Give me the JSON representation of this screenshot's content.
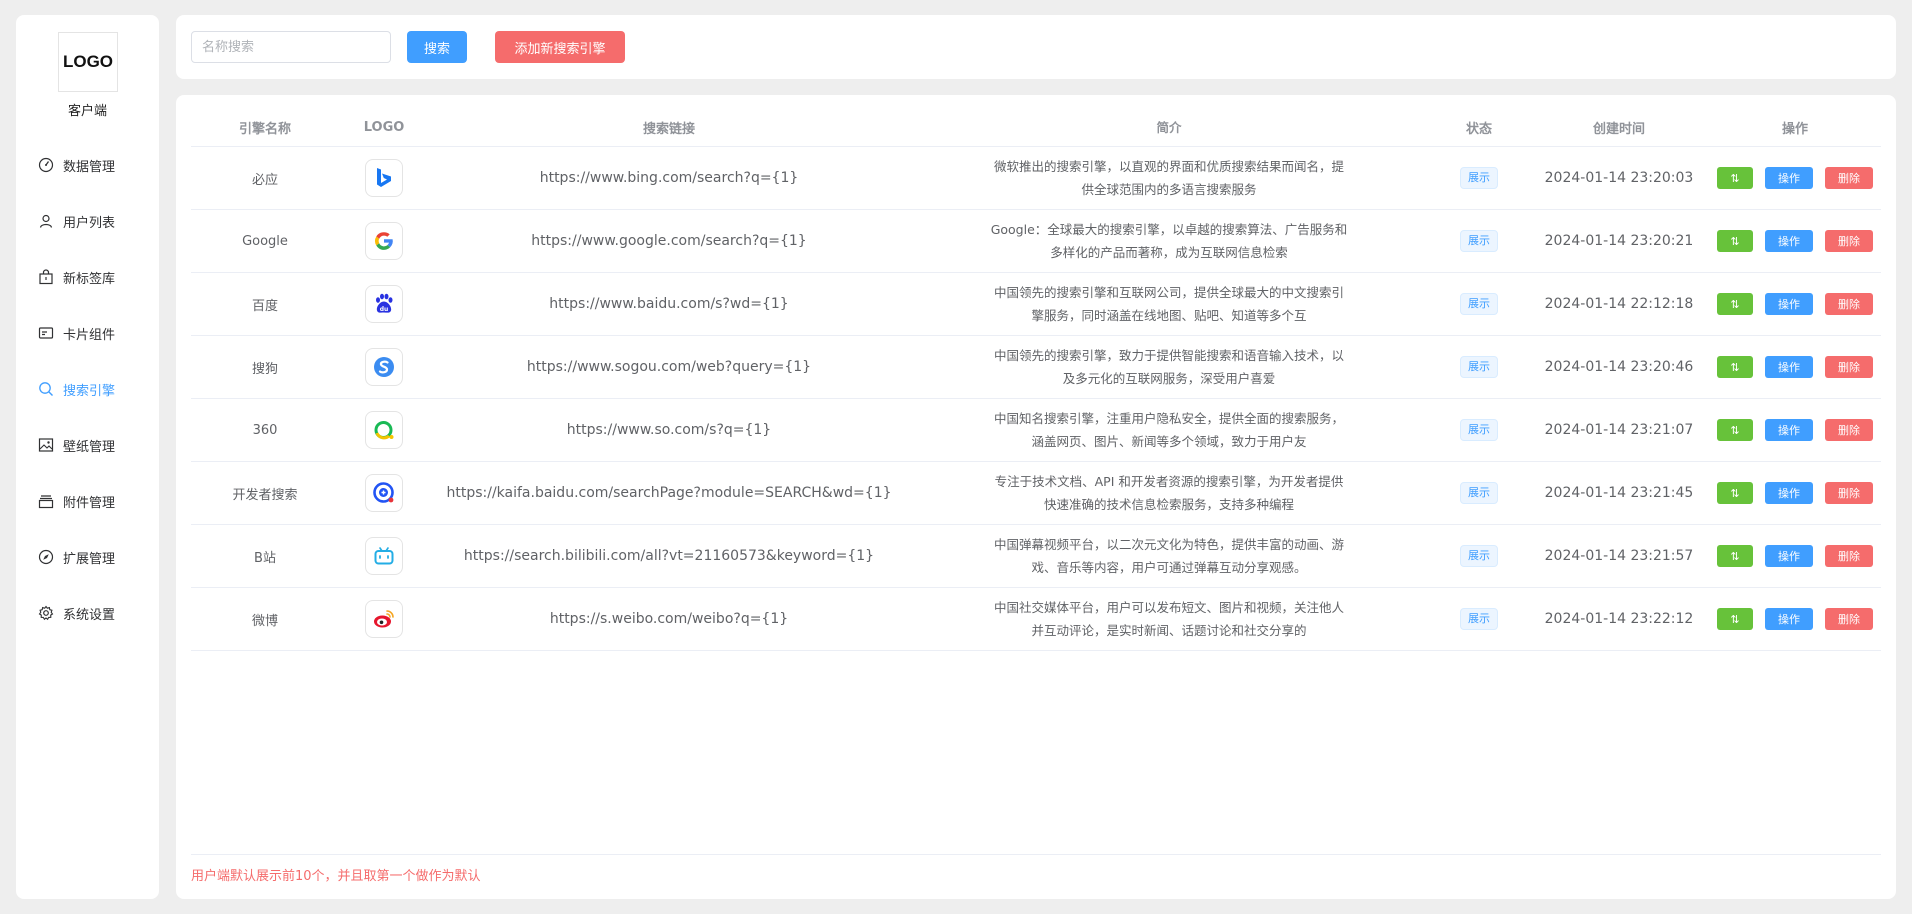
{
  "sidebar": {
    "logo_text": "LOGO",
    "caption": "客户端",
    "items": [
      {
        "label": "数据管理",
        "icon": "dashboard-icon"
      },
      {
        "label": "用户列表",
        "icon": "user-icon"
      },
      {
        "label": "新标签库",
        "icon": "shopping-bag-icon"
      },
      {
        "label": "卡片组件",
        "icon": "card-icon"
      },
      {
        "label": "搜索引擎",
        "icon": "search-icon",
        "active": true
      },
      {
        "label": "壁纸管理",
        "icon": "picture-icon"
      },
      {
        "label": "附件管理",
        "icon": "box-icon"
      },
      {
        "label": "扩展管理",
        "icon": "compass-icon"
      },
      {
        "label": "系统设置",
        "icon": "gear-icon"
      }
    ]
  },
  "toolbar": {
    "search_placeholder": "名称搜索",
    "search_value": "",
    "search_label": "搜索",
    "add_label": "添加新搜索引擎"
  },
  "table": {
    "headers": {
      "name": "引擎名称",
      "logo": "LOGO",
      "url": "搜索链接",
      "desc": "简介",
      "status": "状态",
      "time": "创建时间",
      "ops": "操作"
    },
    "status_label": "展示",
    "sort_label": "⇅",
    "op_label": "操作",
    "del_label": "删除",
    "rows": [
      {
        "name": "必应",
        "logo": "bing-logo-icon",
        "url": "https://www.bing.com/search?q={1}",
        "desc1": "微软推出的搜索引擎，以直观的界面和优质搜索结果而闻名，提",
        "desc2": "供全球范围内的多语言搜索服务",
        "time": "2024-01-14 23:20:03"
      },
      {
        "name": "Google",
        "logo": "google-logo-icon",
        "url": "https://www.google.com/search?q={1}",
        "desc1": "Google：全球最大的搜索引擎，以卓越的搜索算法、广告服务和",
        "desc2": "多样化的产品而著称，成为互联网信息检索",
        "time": "2024-01-14 23:20:21"
      },
      {
        "name": "百度",
        "logo": "baidu-logo-icon",
        "url": "https://www.baidu.com/s?wd={1}",
        "desc1": "中国领先的搜索引擎和互联网公司，提供全球最大的中文搜索引",
        "desc2": "擎服务，同时涵盖在线地图、贴吧、知道等多个互",
        "time": "2024-01-14 22:12:18"
      },
      {
        "name": "搜狗",
        "logo": "sogou-logo-icon",
        "url": "https://www.sogou.com/web?query={1}",
        "desc1": "中国领先的搜索引擎，致力于提供智能搜索和语音输入技术，以",
        "desc2": "及多元化的互联网服务，深受用户喜爱",
        "time": "2024-01-14 23:20:46"
      },
      {
        "name": "360",
        "logo": "so360-logo-icon",
        "url": "https://www.so.com/s?q={1}",
        "desc1": "中国知名搜索引擎，注重用户隐私安全，提供全面的搜索服务，",
        "desc2": "涵盖网页、图片、新闻等多个领域，致力于用户友",
        "time": "2024-01-14 23:21:07"
      },
      {
        "name": "开发者搜索",
        "logo": "kaifa-logo-icon",
        "url": "https://kaifa.baidu.com/searchPage?module=SEARCH&wd={1}",
        "desc1": "专注于技术文档、API 和开发者资源的搜索引擎，为开发者提供",
        "desc2": "快速准确的技术信息检索服务，支持多种编程",
        "time": "2024-01-14 23:21:45"
      },
      {
        "name": "B站",
        "logo": "bilibili-logo-icon",
        "url": "https://search.bilibili.com/all?vt=21160573&keyword={1}",
        "desc1": "中国弹幕视频平台，以二次元文化为特色，提供丰富的动画、游",
        "desc2": "戏、音乐等内容，用户可通过弹幕互动分享观感。",
        "time": "2024-01-14 23:21:57"
      },
      {
        "name": "微博",
        "logo": "weibo-logo-icon",
        "url": "https://s.weibo.com/weibo?q={1}",
        "desc1": "中国社交媒体平台，用户可以发布短文、图片和视频，关注他人",
        "desc2": "并互动评论，是实时新闻、话题讨论和社交分享的",
        "time": "2024-01-14 23:22:12"
      }
    ]
  },
  "footer": {
    "note": "用户端默认展示前10个，并且取第一个做作为默认"
  },
  "colors": {
    "primary": "#409eff",
    "success": "#67c23a",
    "danger": "#f56c6c"
  }
}
